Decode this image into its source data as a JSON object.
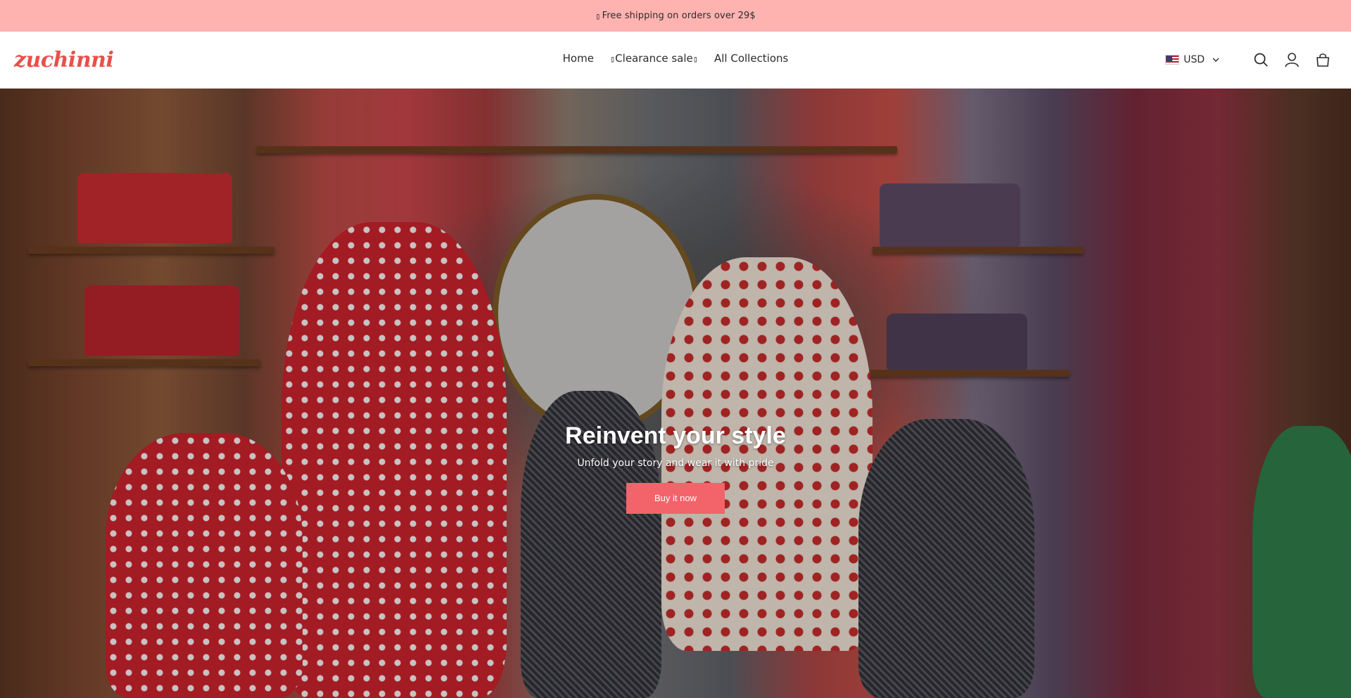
{
  "announcement": {
    "glyph": "▯",
    "text": "Free shipping on orders over 29$"
  },
  "header": {
    "logo": "zuchinni",
    "nav": [
      {
        "label": "Home"
      },
      {
        "label": "Clearance sale",
        "glyph": "▯"
      },
      {
        "label": "All Collections"
      }
    ],
    "currency": "USD",
    "icons": [
      "search-icon",
      "account-icon",
      "cart-icon"
    ]
  },
  "hero": {
    "title": "Reinvent your style",
    "subtitle": "Unfold your story and wear it with pride",
    "button_label": "Buy it now"
  },
  "colors": {
    "announcement_bg": "#ffb3b0",
    "logo": "#e8504a",
    "button": "#f2646a"
  }
}
